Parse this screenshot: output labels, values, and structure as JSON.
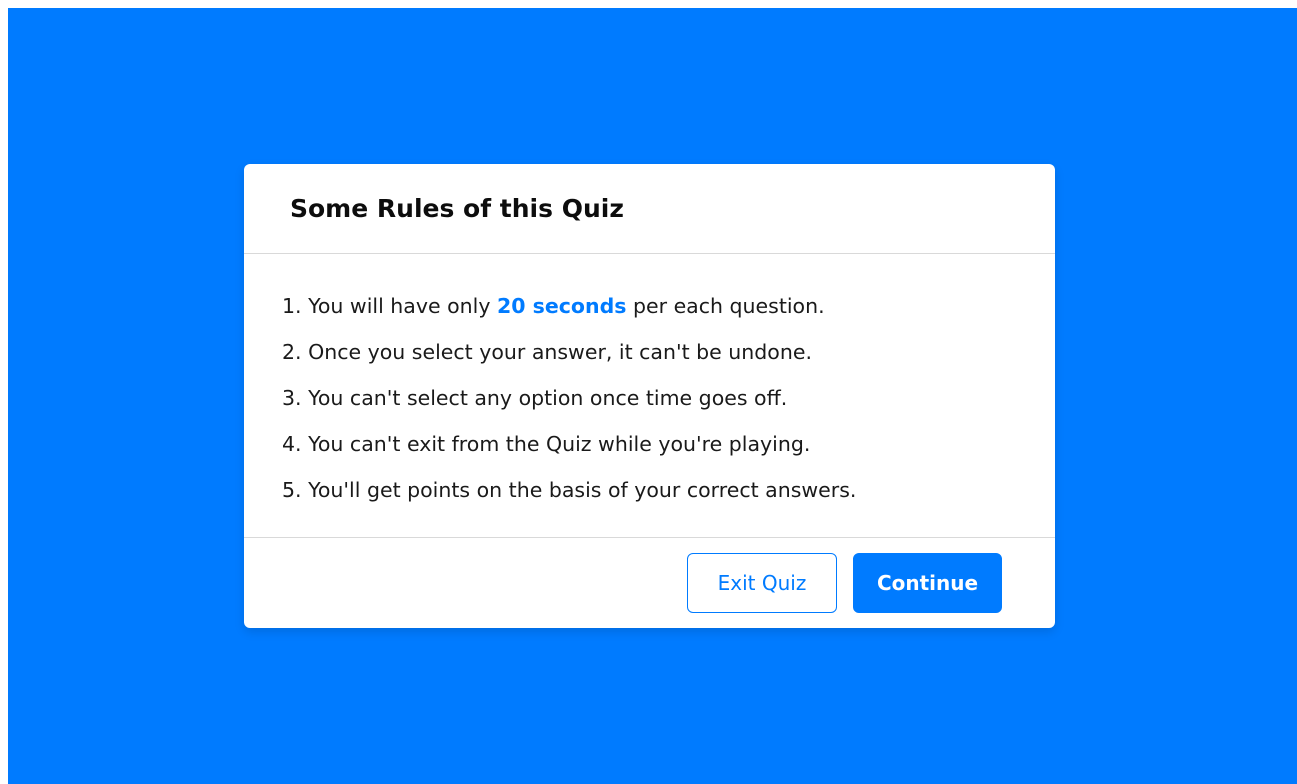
{
  "dialog": {
    "title": "Some Rules of this Quiz",
    "rules": [
      {
        "prefix": "1. You will have only ",
        "highlight": "20 seconds",
        "suffix": " per each question."
      },
      {
        "text": "2. Once you select your answer, it can't be undone."
      },
      {
        "text": "3. You can't select any option once time goes off."
      },
      {
        "text": "4. You can't exit from the Quiz while you're playing."
      },
      {
        "text": "5. You'll get points on the basis of your correct answers."
      }
    ],
    "buttons": {
      "exit_label": "Exit Quiz",
      "continue_label": "Continue"
    }
  },
  "colors": {
    "background": "#007bff",
    "accent": "#007bff",
    "card": "#ffffff"
  }
}
